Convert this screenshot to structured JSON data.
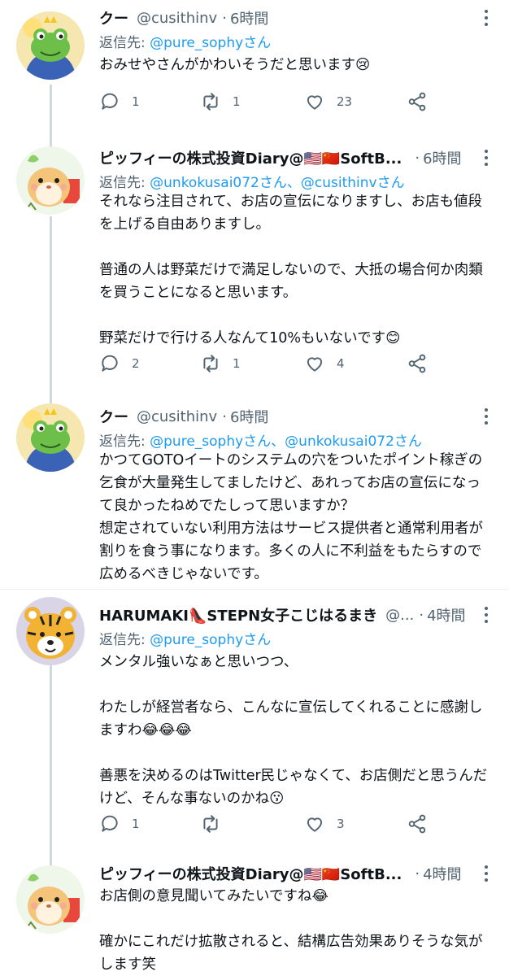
{
  "tweets": [
    {
      "name": "クー",
      "handle": "@cusithinv",
      "time": "6時間",
      "reply_prefix": "返信先: ",
      "reply_links": "@pure_sophyさん",
      "body": "おみせやさんがかわいそうだと思います😢",
      "replies": "1",
      "retweets": "1",
      "likes": "23",
      "avatar": "frog-avatar"
    },
    {
      "name": "ピッフィーの株式投資Diary@🇺🇸🇨🇳SoftB...",
      "handle": "",
      "time": "6時間",
      "reply_prefix": "返信先: ",
      "reply_links": "@unkokusai072さん、@cusithinvさん",
      "body": "それなら注目されて、お店の宣伝になりますし、お店も値段を上げる自由ありますし。\n\n普通の人は野菜だけで満足しないので、大抵の場合何か肉類を買うことになると思います。\n\n野菜だけで行ける人なんて10%もいないです😊",
      "replies": "2",
      "retweets": "1",
      "likes": "4",
      "avatar": "hamster-avatar"
    },
    {
      "name": "クー",
      "handle": "@cusithinv",
      "time": "6時間",
      "reply_prefix": "返信先: ",
      "reply_links": "@pure_sophyさん、@unkokusai072さん",
      "body": "かつてGOTOイートのシステムの穴をついたポイント稼ぎの乞食が大量発生してましたけど、あれってお店の宣伝になって良かったねめでたしって思いますか？\n想定されていない利用方法はサービス提供者と通常利用者が割りを食う事になります。多くの人に不利益をもたらすので広めるべきじゃないです。",
      "replies": "",
      "retweets": "",
      "likes": "",
      "avatar": "frog-avatar"
    },
    {
      "name": "HARUMAKI👠STEPN女子こじはるまき",
      "handle": "@...",
      "time": "4時間",
      "reply_prefix": "返信先: ",
      "reply_links": "@pure_sophyさん",
      "body": "メンタル強いなぁと思いつつ、\n\nわたしが経営者なら、こんなに宣伝してくれることに感謝しますわ😂😂😂\n\n善悪を決めるのはTwitter民じゃなくて、お店側だと思うんだけど、そんな事ないのかね😗",
      "replies": "1",
      "retweets": "",
      "likes": "3",
      "avatar": "tiger-avatar"
    },
    {
      "name": "ピッフィーの株式投資Diary@🇺🇸🇨🇳SoftB...",
      "handle": "",
      "time": "4時間",
      "reply_prefix": "",
      "reply_links": "",
      "body": "お店側の意見聞いてみたいですね😂\n\n確かにこれだけ拡散されると、結構広告効果ありそうな気がします笑",
      "replies": "",
      "retweets": "",
      "likes": "",
      "avatar": "hamster-avatar"
    }
  ],
  "colors": {
    "text": "#0f1419",
    "secondary": "#536471",
    "link": "#1d9bf0",
    "line": "#cfd9de"
  }
}
